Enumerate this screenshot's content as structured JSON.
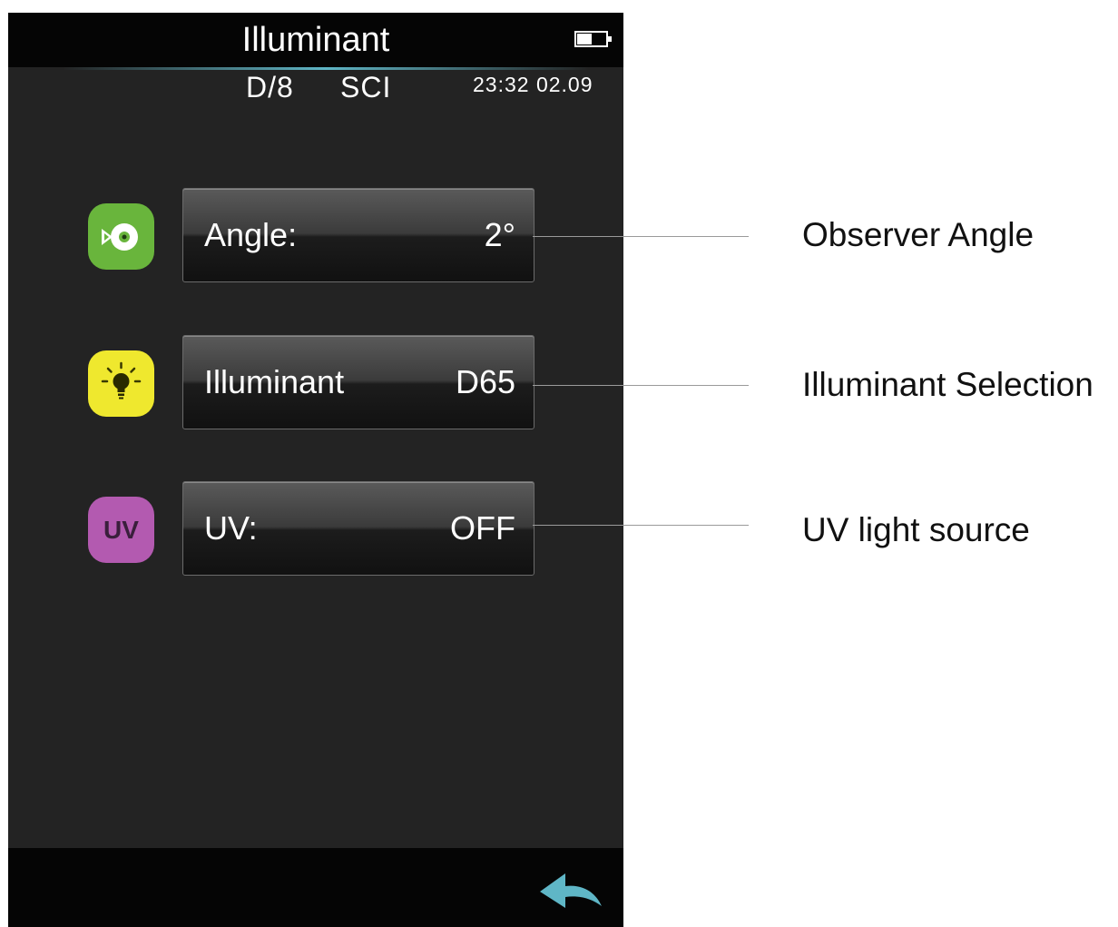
{
  "screen": {
    "title": "Illuminant",
    "status": {
      "battery_icon": "battery-icon",
      "geometry": "D/8",
      "specular_mode": "SCI",
      "time": "23:32",
      "date": "02.09"
    },
    "settings": [
      {
        "label": "Angle:",
        "value": "2°",
        "icon": "observer-eye-icon",
        "icon_color": "#69b53c"
      },
      {
        "label": "Illuminant",
        "value": "D65",
        "icon": "lightbulb-icon",
        "icon_color": "#efe82e"
      },
      {
        "label": "UV:",
        "value": "OFF",
        "icon": "uv-icon",
        "icon_text": "UV",
        "icon_color": "#b35ab0"
      }
    ],
    "back_icon": "back-arrow-icon",
    "accent_color": "#5fb6c6"
  },
  "callouts": [
    {
      "text": "Observer Angle"
    },
    {
      "text": "Illuminant Selection"
    },
    {
      "text": "UV light source"
    }
  ]
}
